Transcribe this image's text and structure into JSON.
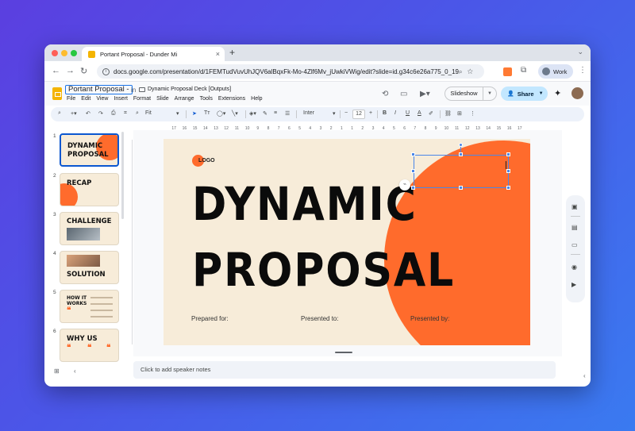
{
  "browser": {
    "tab_title": "Portant Proposal - Dunder Mi",
    "tab_close": "×",
    "new_tab": "+",
    "url": "docs.google.com/presentation/d/1FEMTudVuvUhJQV6alBqxFk-Mo-4Zlf6Mv_jUwkiVWig/edit?slide=id.g34c6e26a775_0_19...",
    "profile": "Work"
  },
  "app": {
    "doc_title": "Portant Proposal -",
    "in_label": "in",
    "folder": "Dynamic Proposal Deck [Outputs]",
    "menu": [
      "File",
      "Edit",
      "View",
      "Insert",
      "Format",
      "Slide",
      "Arrange",
      "Tools",
      "Extensions",
      "Help"
    ],
    "slideshow_label": "Slideshow",
    "share_label": "Share"
  },
  "toolbar": {
    "zoom": "Fit",
    "font": "Inter",
    "font_size": "12",
    "bold": "B",
    "italic": "I",
    "underline": "U",
    "text_color": "A"
  },
  "ruler": [
    "17",
    "16",
    "15",
    "14",
    "13",
    "12",
    "11",
    "10",
    "9",
    "8",
    "7",
    "6",
    "5",
    "4",
    "3",
    "2",
    "1",
    "1",
    "2",
    "3",
    "4",
    "5",
    "6",
    "7",
    "8",
    "9",
    "10",
    "11",
    "12",
    "13",
    "14",
    "15",
    "16",
    "17"
  ],
  "filmstrip": [
    {
      "num": "1",
      "title_lines": [
        "DYNAMIC",
        "PROPOSAL"
      ]
    },
    {
      "num": "2",
      "title_lines": [
        "RECAP"
      ]
    },
    {
      "num": "3",
      "title_lines": [
        "CHALLENGE"
      ]
    },
    {
      "num": "4",
      "title_lines": [
        "SOLUTION"
      ]
    },
    {
      "num": "5",
      "title_lines": [
        "HOW IT",
        "WORKS"
      ]
    },
    {
      "num": "6",
      "title_lines": [
        "WHY US"
      ]
    }
  ],
  "slide": {
    "logo": "LOGO",
    "title_line1": "DYNAMIC",
    "title_line2": "PROPOSAL",
    "prepared_for": "Prepared for:",
    "presented_to": "Presented to:",
    "presented_by": "Presented by:"
  },
  "notes": {
    "placeholder": "Click to add speaker notes"
  },
  "colors": {
    "accent": "#ff6b2c",
    "slide_bg": "#f7ecd9",
    "selection": "#4a86e8"
  }
}
